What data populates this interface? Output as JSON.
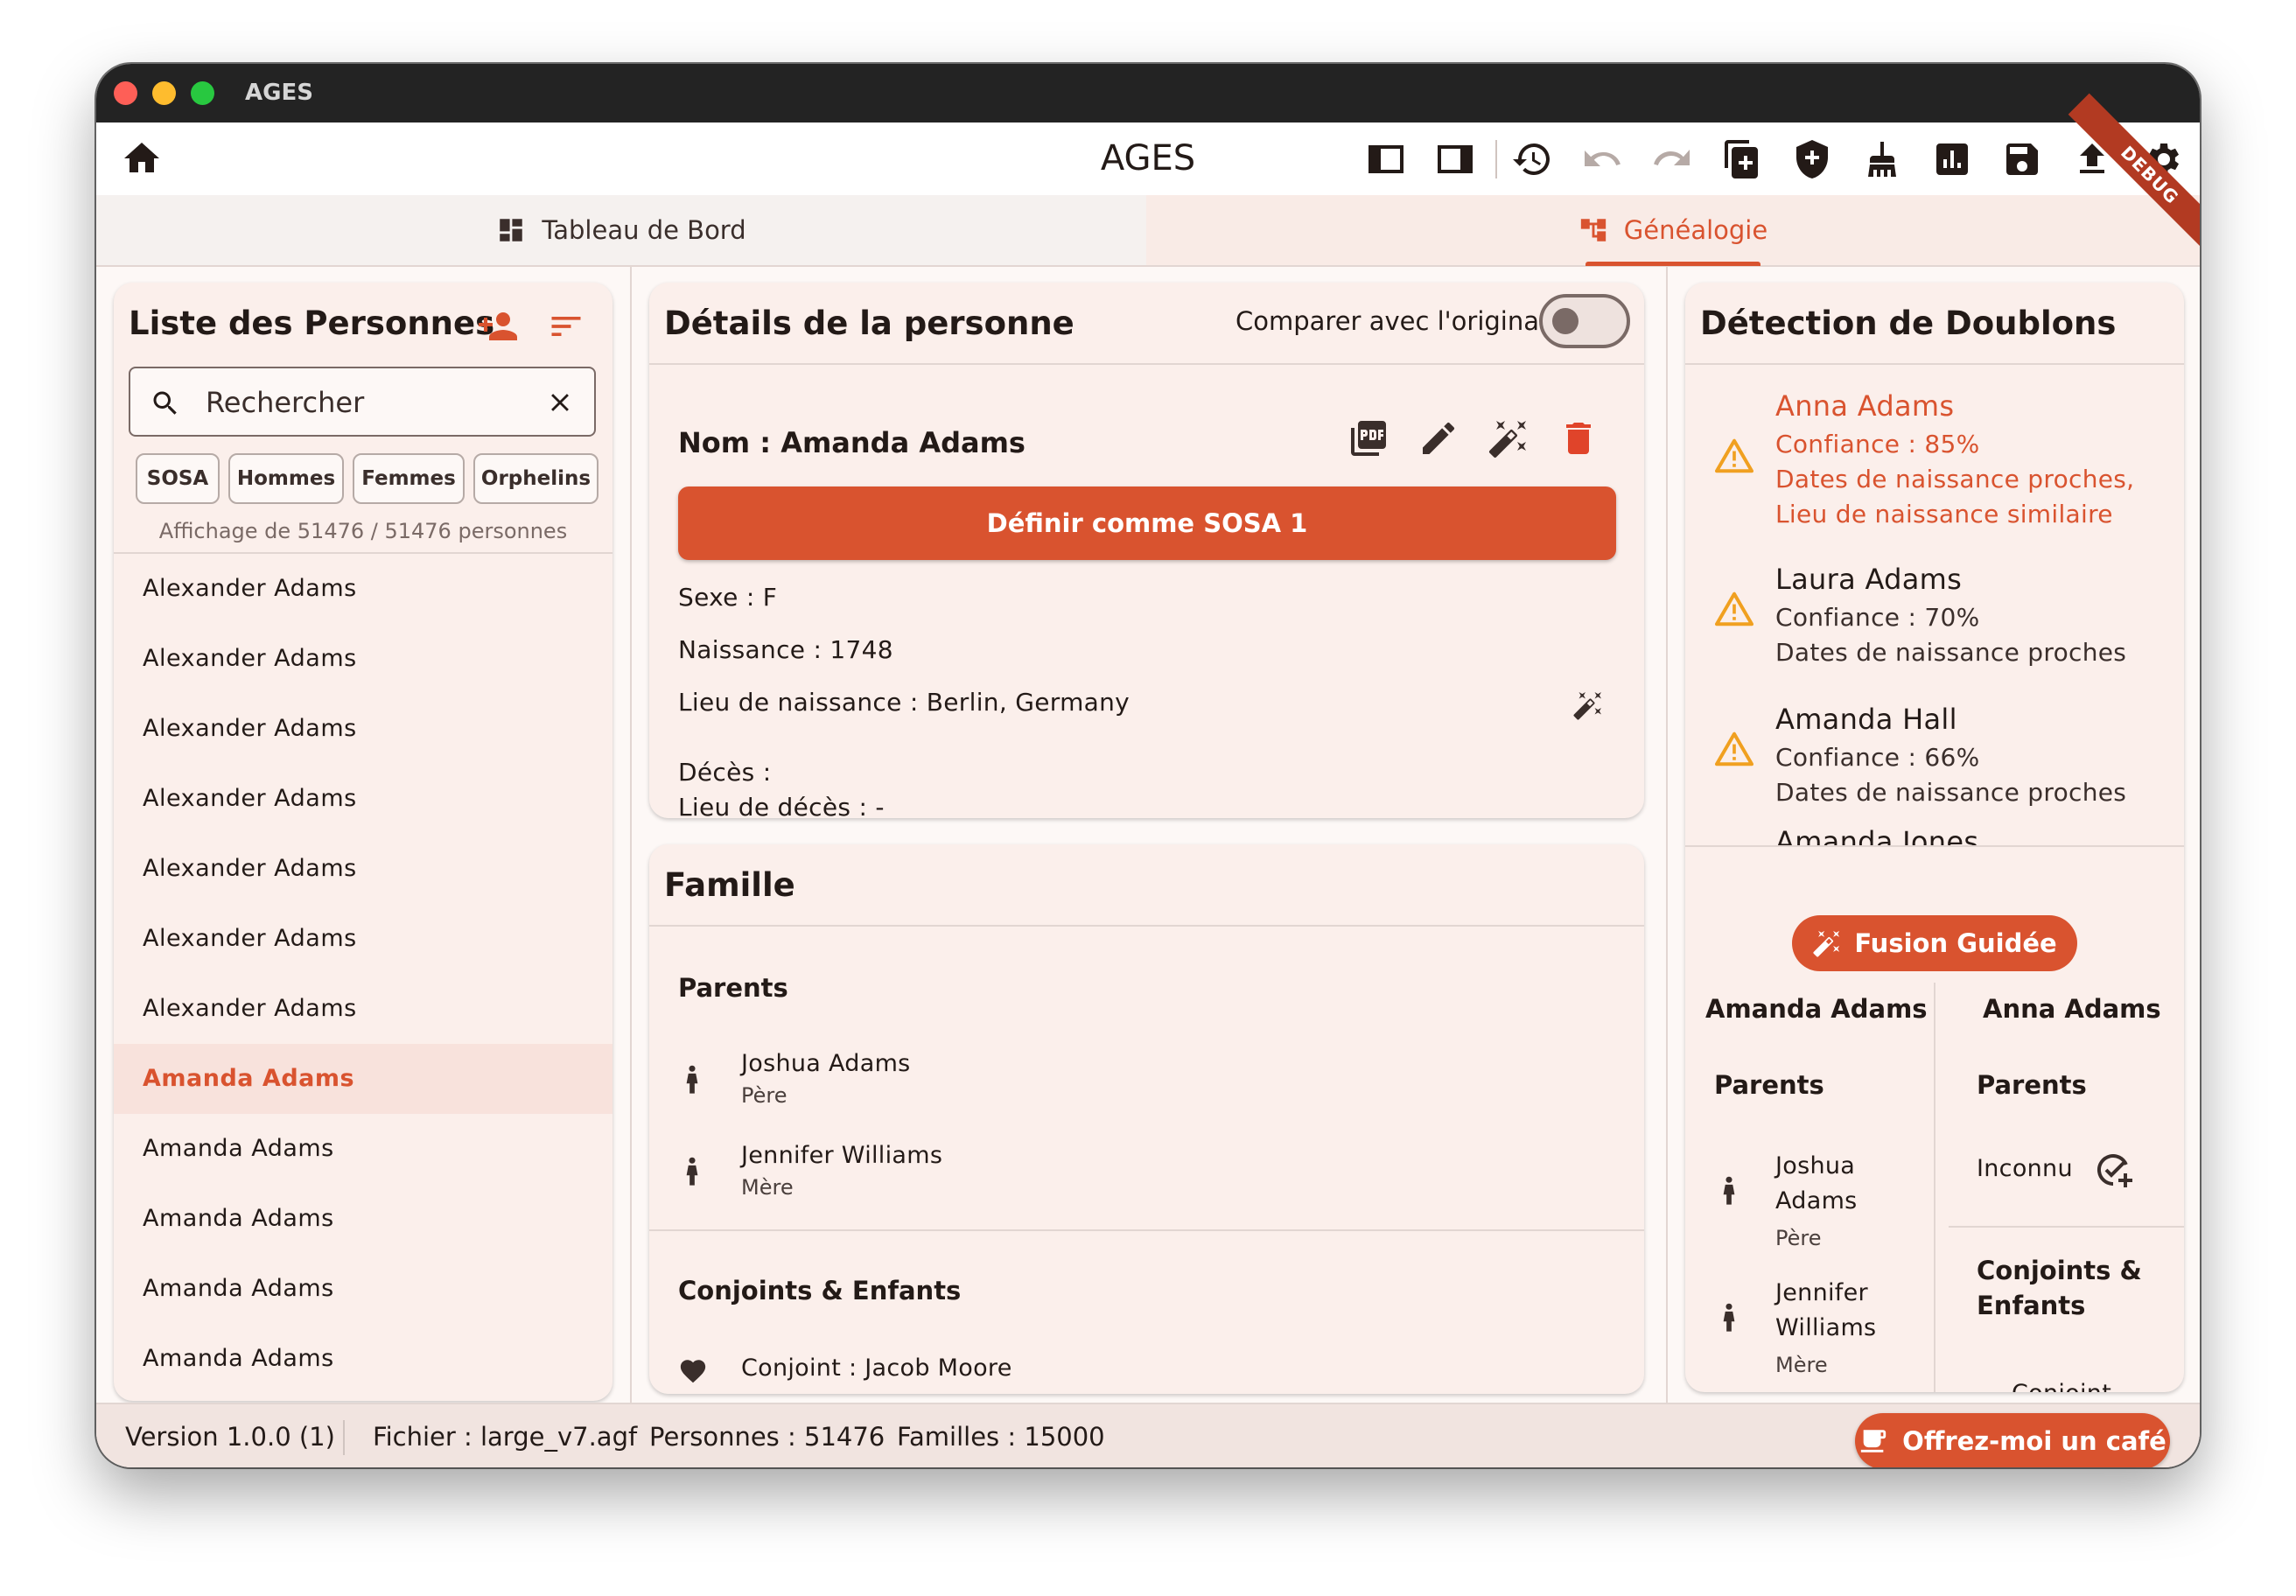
{
  "window": {
    "title": "AGES"
  },
  "appbar": {
    "title": "AGES",
    "icons": [
      "home-icon",
      "panel-left-icon",
      "panel-right-icon",
      "history-icon",
      "undo-icon",
      "redo-icon",
      "add-document-icon",
      "add-shield-icon",
      "broom-icon",
      "analytics-icon",
      "save-icon",
      "upload-icon",
      "settings-icon"
    ],
    "debug_label": "DEBUG"
  },
  "tabs": [
    {
      "label": "Tableau de Bord",
      "icon": "dashboard-icon",
      "active": false
    },
    {
      "label": "Généalogie",
      "icon": "family-tree-icon",
      "active": true
    }
  ],
  "person_list": {
    "title": "Liste des Personnes",
    "search_value": "Rechercher",
    "filters": [
      "SOSA",
      "Hommes",
      "Femmes",
      "Orphelins"
    ],
    "count_text": "Affichage de 51476 / 51476 personnes",
    "items": [
      "Alexander Adams",
      "Alexander Adams",
      "Alexander Adams",
      "Alexander Adams",
      "Alexander Adams",
      "Alexander Adams",
      "Alexander Adams",
      "Amanda Adams",
      "Amanda Adams",
      "Amanda Adams",
      "Amanda Adams",
      "Amanda Adams"
    ],
    "selected_index": 7
  },
  "details": {
    "title": "Détails de la personne",
    "compare_label": "Comparer avec l'original",
    "compare_on": false,
    "name_line": "Nom : Amanda Adams",
    "sosa_button": "Définir comme SOSA 1",
    "sex": "Sexe : F",
    "birth": "Naissance : 1748",
    "birth_place": "Lieu de naissance : Berlin, Germany",
    "death": "Décès :",
    "death_place": "Lieu de décès : -"
  },
  "family": {
    "title": "Famille",
    "parents_heading": "Parents",
    "parents": [
      {
        "name": "Joshua Adams",
        "role": "Père"
      },
      {
        "name": "Jennifer Williams",
        "role": "Mère"
      }
    ],
    "spouses_heading": "Conjoints & Enfants",
    "spouse": "Conjoint : Jacob Moore"
  },
  "duplicates": {
    "title": "Détection de Doublons",
    "items": [
      {
        "name": "Anna Adams",
        "confidence": "Confiance : 85%",
        "reason_1": "Dates de naissance proches,",
        "reason_2": "Lieu de naissance similaire"
      },
      {
        "name": "Laura Adams",
        "confidence": "Confiance : 70%",
        "reason_1": "Dates de naissance proches"
      },
      {
        "name": "Amanda Hall",
        "confidence": "Confiance : 66%",
        "reason_1": "Dates de naissance proches"
      },
      {
        "name": "Amanda Jones"
      }
    ],
    "fusion_button": "Fusion Guidée",
    "compare": {
      "left_name": "Amanda Adams",
      "right_name": "Anna Adams",
      "parents_heading": "Parents",
      "left_parents": [
        {
          "first": "Joshua",
          "last": "Adams",
          "role": "Père"
        },
        {
          "first": "Jennifer",
          "last": "Williams",
          "role": "Mère"
        }
      ],
      "right_parent": "Inconnu",
      "spouses_heading_1": "Conjoints &",
      "spouses_heading_2": "Enfants",
      "right_partial": "Conjoint"
    }
  },
  "statusbar": {
    "version": "Version 1.0.0 (1)",
    "file": "Fichier : large_v7.agf",
    "persons": "Personnes : 51476",
    "families": "Familles : 15000",
    "coffee_button": "Offrez-moi un café"
  },
  "colors": {
    "accent": "#d9532f",
    "card_bg": "#fbefeb",
    "window_bg": "#fdf8f6",
    "titlebar": "#232323",
    "warning": "#f0a020"
  }
}
